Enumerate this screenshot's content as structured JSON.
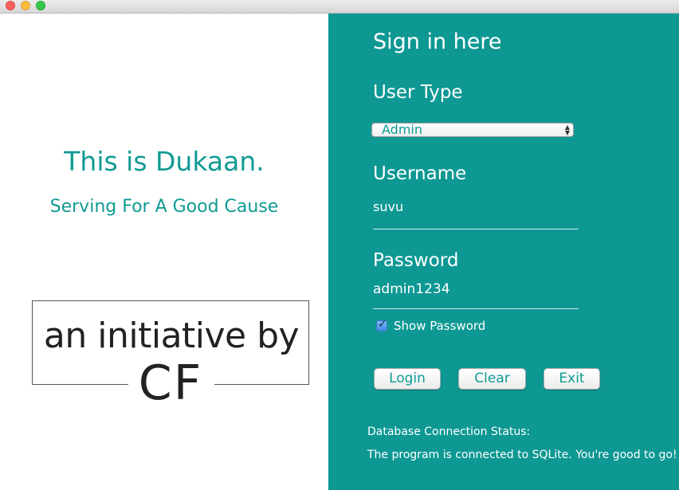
{
  "window": {
    "controls": [
      "close",
      "minimize",
      "zoom"
    ]
  },
  "brand": {
    "title": "This is Dukaan.",
    "tagline": "Serving For A Good Cause",
    "logo_line1": "an initiative by",
    "logo_line2": "CF"
  },
  "signin": {
    "heading": "Sign in here",
    "user_type_label": "User Type",
    "user_type_value": "Admin",
    "username_label": "Username",
    "username_value": "suvu",
    "password_label": "Password",
    "password_value": "admin1234",
    "show_password_label": "Show Password",
    "show_password_checked": true,
    "buttons": {
      "login": "Login",
      "clear": "Clear",
      "exit": "Exit"
    }
  },
  "status": {
    "label": "Database Connection Status:",
    "message": "The program is connected to SQLite. You're good to go!"
  },
  "colors": {
    "accent": "#0e9893",
    "panel_text": "#ffffff"
  }
}
